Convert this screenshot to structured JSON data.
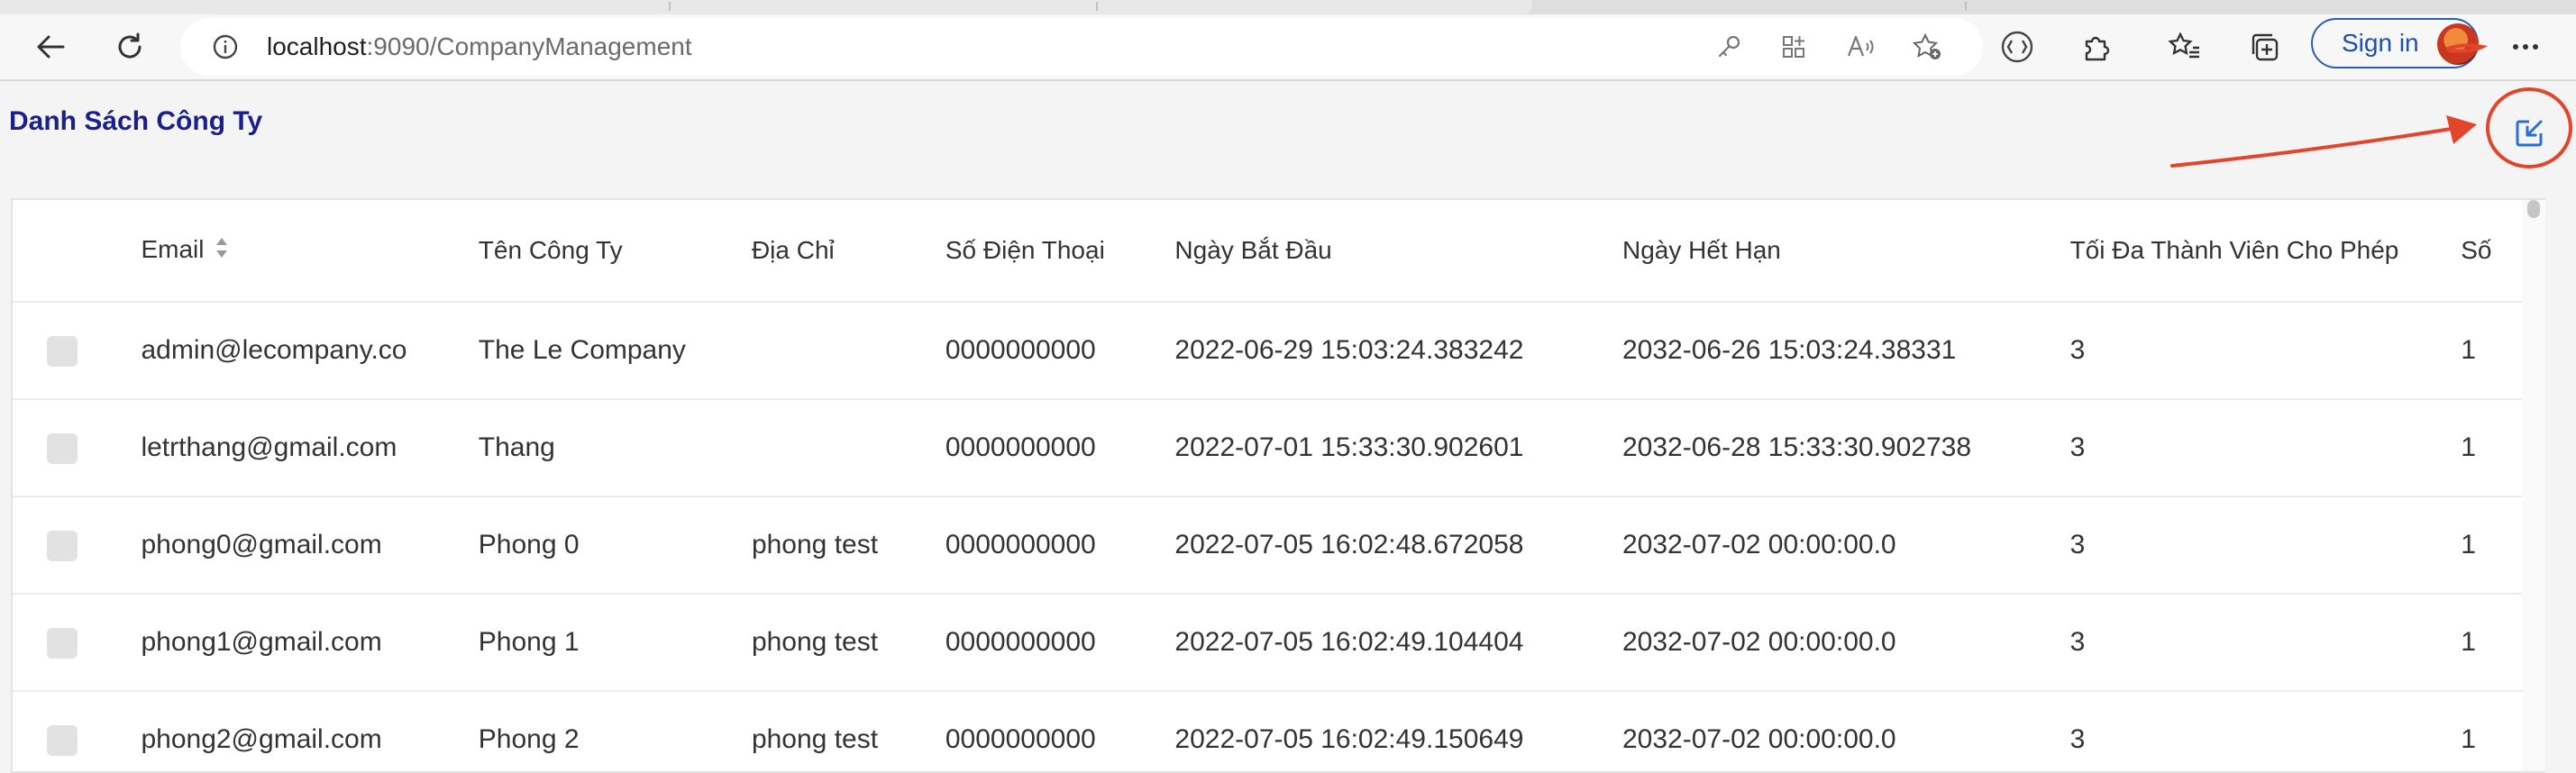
{
  "browser": {
    "url_host": "localhost",
    "url_rest": ":9090/CompanyManagement",
    "signin_label": "Sign in"
  },
  "page": {
    "title": "Danh Sách Công Ty"
  },
  "table": {
    "columns": [
      "Email",
      "Tên Công Ty",
      "Địa Chỉ",
      "Số Điện Thoại",
      "Ngày Bắt Đầu",
      "Ngày Hết Hạn",
      "Tối Đa Thành Viên Cho Phép",
      "Số"
    ],
    "rows": [
      {
        "email": "admin@lecompany.co",
        "name": "The Le Company",
        "address": "",
        "phone": "0000000000",
        "start": "2022-06-29 15:03:24.383242",
        "end": "2032-06-26 15:03:24.38331",
        "max_members": "3",
        "extra": "1"
      },
      {
        "email": "letrthang@gmail.com",
        "name": "Thang",
        "address": "",
        "phone": "0000000000",
        "start": "2022-07-01 15:33:30.902601",
        "end": "2032-06-28 15:33:30.902738",
        "max_members": "3",
        "extra": "1"
      },
      {
        "email": "phong0@gmail.com",
        "name": "Phong 0",
        "address": "phong test",
        "phone": "0000000000",
        "start": "2022-07-05 16:02:48.672058",
        "end": "2032-07-02 00:00:00.0",
        "max_members": "3",
        "extra": "1"
      },
      {
        "email": "phong1@gmail.com",
        "name": "Phong 1",
        "address": "phong test",
        "phone": "0000000000",
        "start": "2022-07-05 16:02:49.104404",
        "end": "2032-07-02 00:00:00.0",
        "max_members": "3",
        "extra": "1"
      },
      {
        "email": "phong2@gmail.com",
        "name": "Phong 2",
        "address": "phong test",
        "phone": "0000000000",
        "start": "2022-07-05 16:02:49.150649",
        "end": "2032-07-02 00:00:00.0",
        "max_members": "3",
        "extra": "1"
      }
    ]
  },
  "icons": {
    "toolbar": [
      "back-icon",
      "refresh-icon",
      "info-icon",
      "key-icon",
      "app-grid-icon",
      "read-aloud-icon",
      "add-favorite-icon",
      "immersive-reader-icon",
      "extensions-icon",
      "favorites-icon",
      "collections-icon",
      "more-icon"
    ],
    "page": [
      "collapse-fullscreen-icon",
      "sort-icon"
    ]
  },
  "colors": {
    "title": "#1b1f8c",
    "accent_blue": "#2a5db8",
    "annotation_red": "#e2452b"
  }
}
